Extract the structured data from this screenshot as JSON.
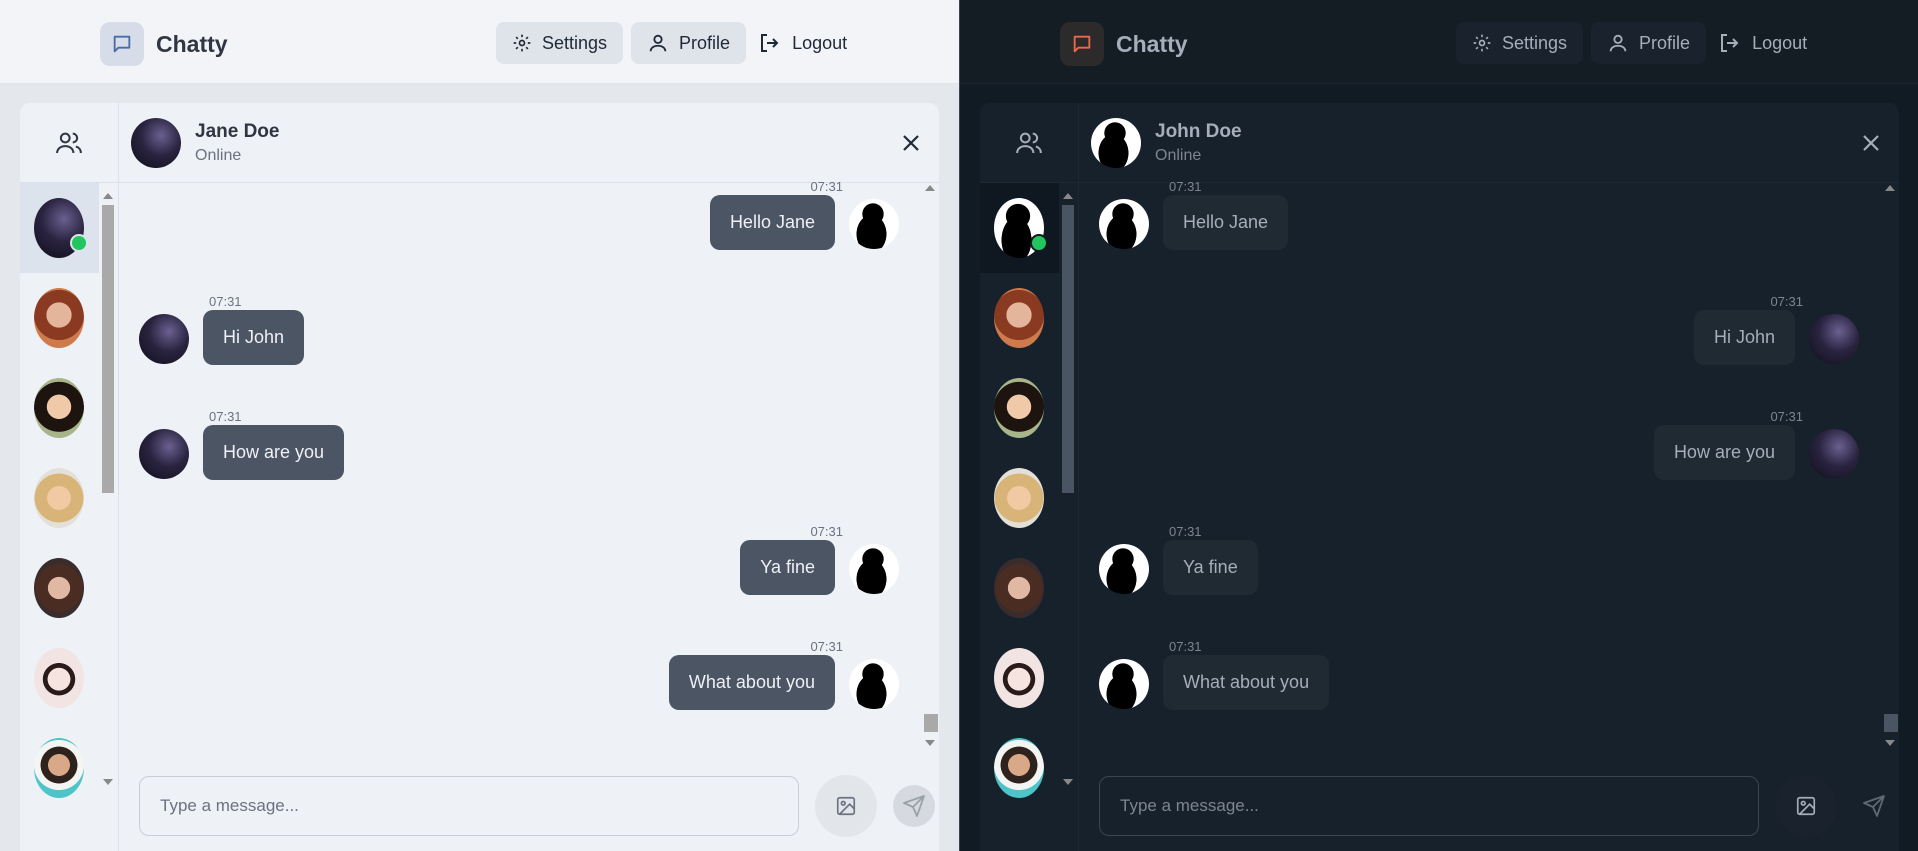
{
  "brand": {
    "name": "Chatty"
  },
  "nav": {
    "settings": "Settings",
    "profile": "Profile",
    "logout": "Logout"
  },
  "colors": {
    "light_accent": "#4b5563",
    "dark_accent": "#ea6b4b",
    "online": "#22c55e"
  },
  "light": {
    "chat_header": {
      "name": "Jane Doe",
      "status": "Online"
    },
    "messages": [
      {
        "time": "07:31",
        "text": "Hello Jane",
        "side": "right"
      },
      {
        "time": "07:31",
        "text": "Hi John",
        "side": "left"
      },
      {
        "time": "07:31",
        "text": "How are you",
        "side": "left"
      },
      {
        "time": "07:31",
        "text": "Ya fine",
        "side": "right"
      },
      {
        "time": "07:31",
        "text": "What about you",
        "side": "right"
      }
    ],
    "composer": {
      "placeholder": "Type a message..."
    }
  },
  "dark": {
    "chat_header": {
      "name": "John Doe",
      "status": "Online"
    },
    "messages": [
      {
        "time": "07:31",
        "text": "Hello Jane",
        "side": "left"
      },
      {
        "time": "07:31",
        "text": "Hi John",
        "side": "right"
      },
      {
        "time": "07:31",
        "text": "How are you",
        "side": "right"
      },
      {
        "time": "07:31",
        "text": "Ya fine",
        "side": "left"
      },
      {
        "time": "07:31",
        "text": "What about you",
        "side": "left"
      }
    ],
    "composer": {
      "placeholder": "Type a message..."
    }
  },
  "icons": {
    "brand": "chat-bubble-icon",
    "settings": "gear-icon",
    "profile": "user-icon",
    "logout": "logout-icon",
    "contacts": "users-icon",
    "close": "close-icon",
    "image": "image-icon",
    "send": "send-icon"
  }
}
